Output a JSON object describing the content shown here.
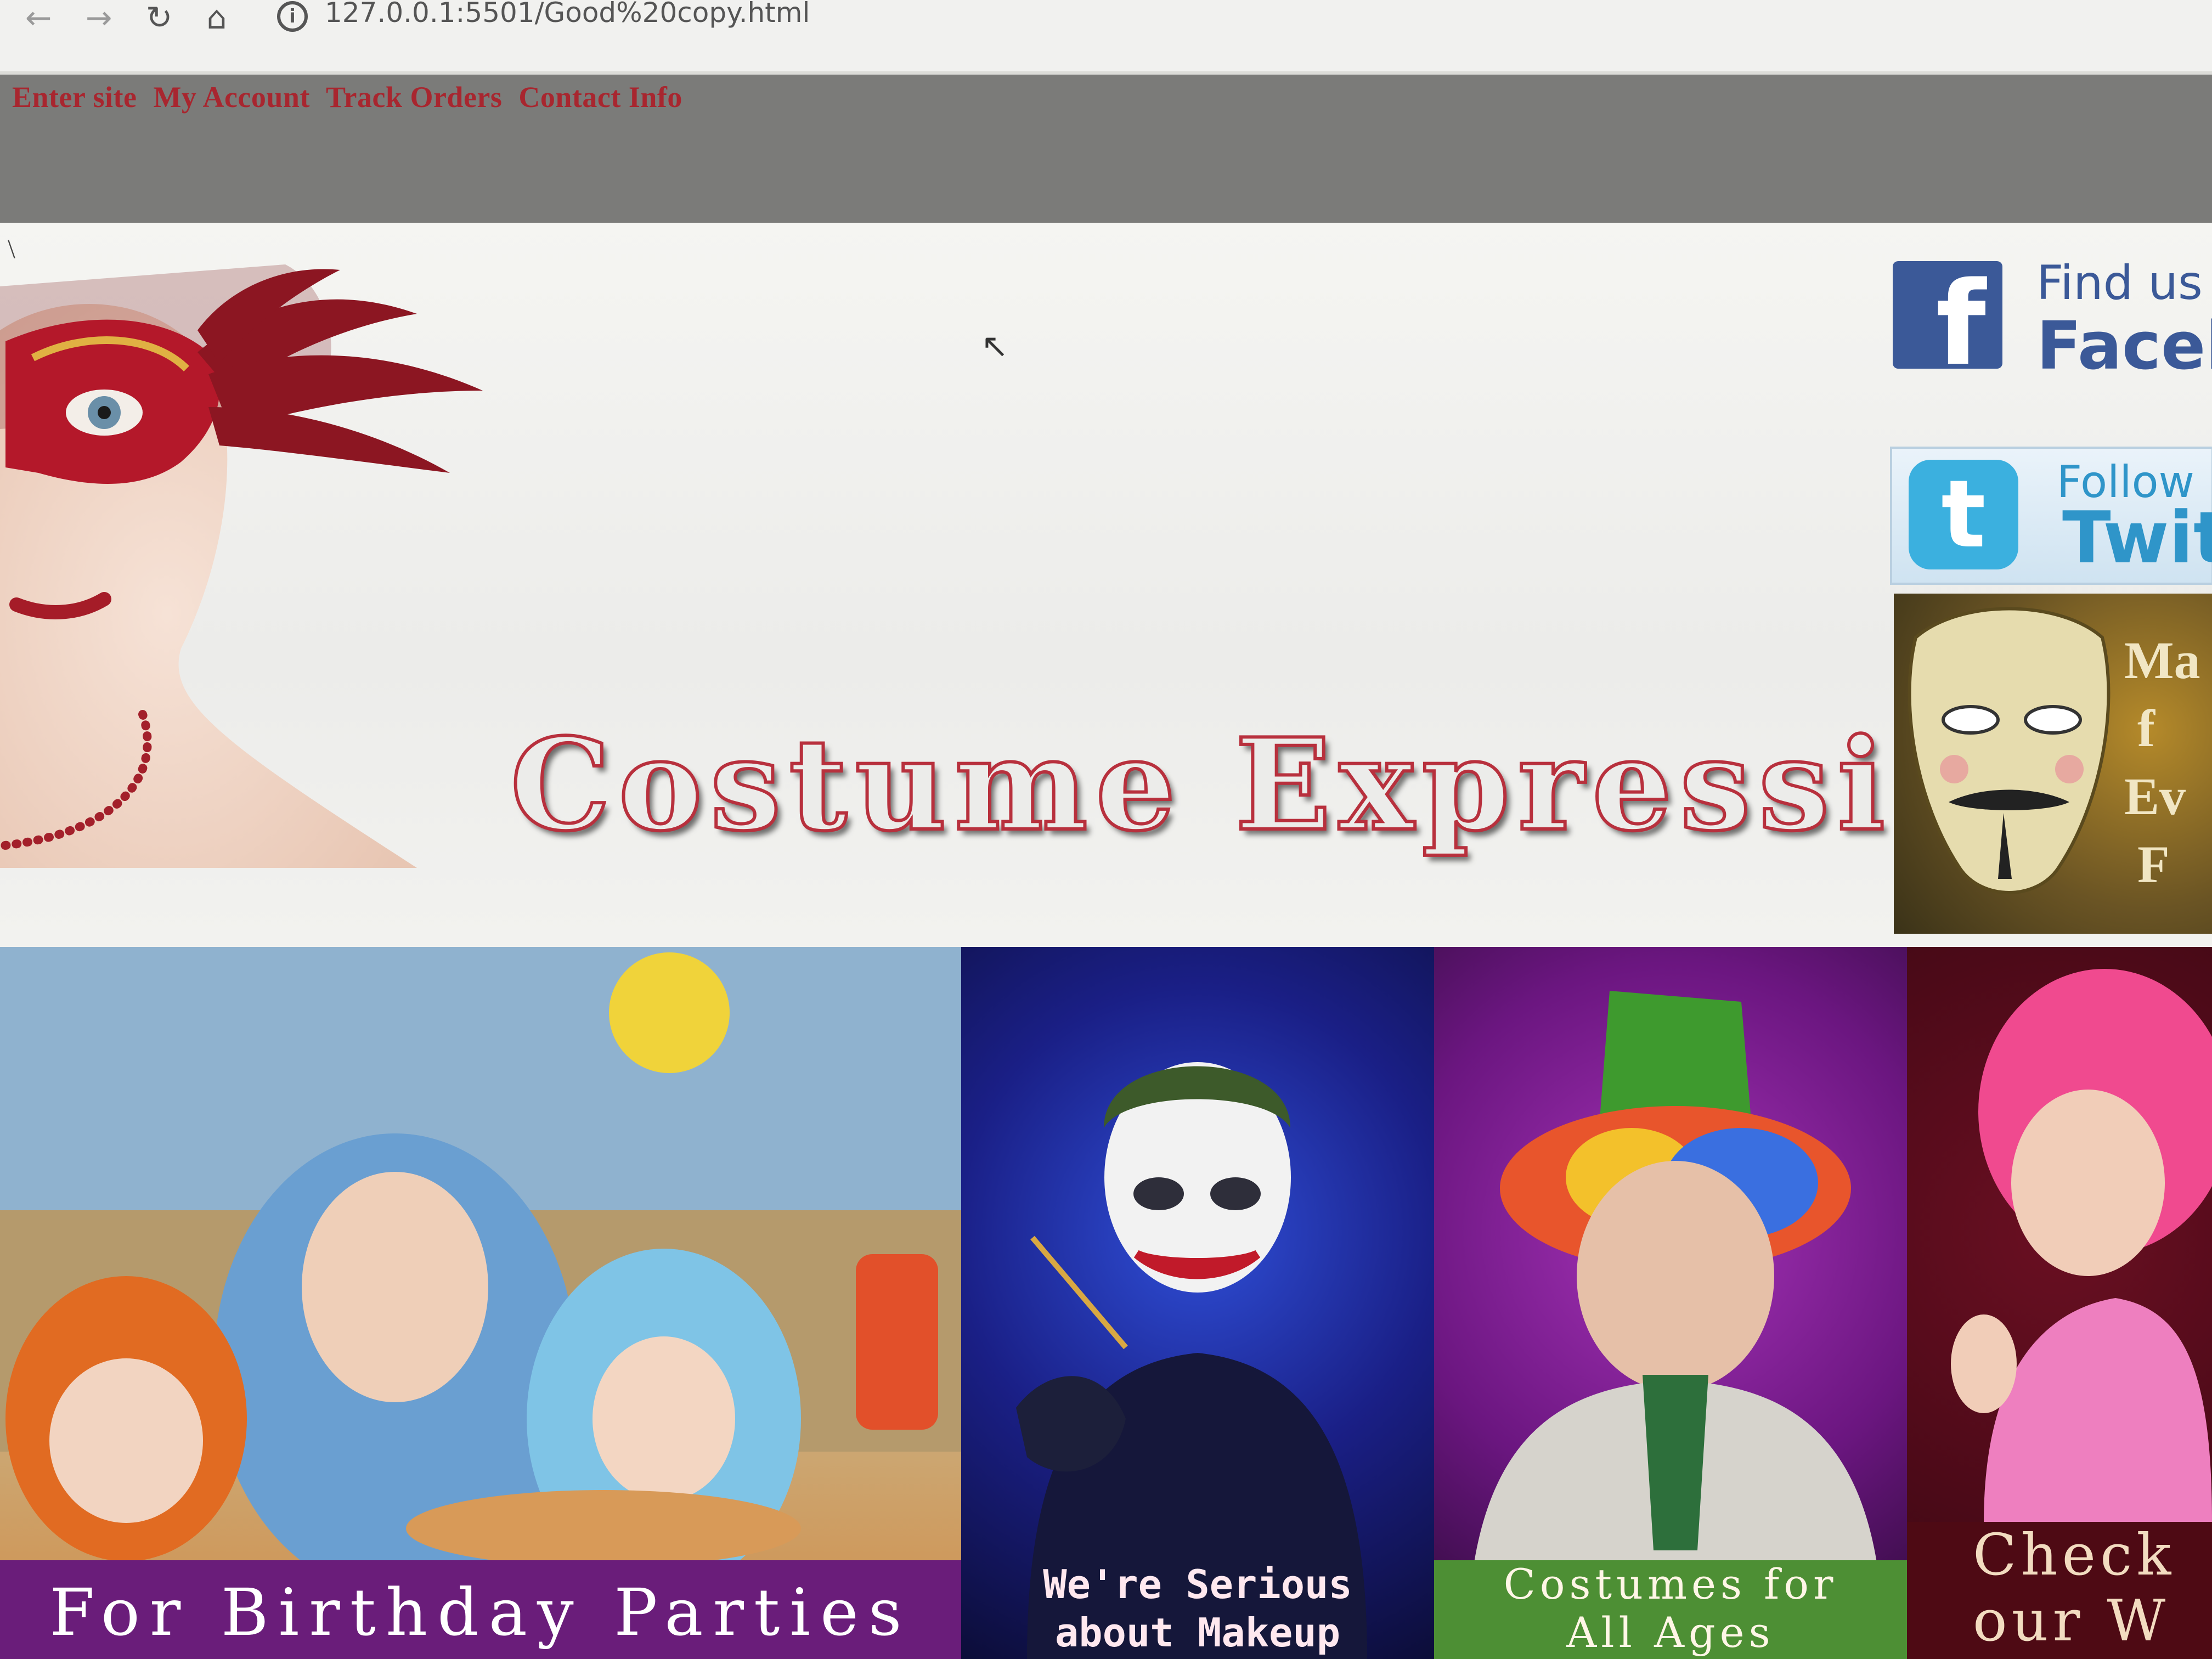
{
  "browser": {
    "back_icon": "←",
    "forward_icon": "→",
    "reload_icon": "↻",
    "home_icon": "⌂",
    "info_icon": "i",
    "url": "127.0.0.1:5501/Good%20copy.html"
  },
  "nav": {
    "links": [
      "Enter site",
      "My Account",
      "Track Orders",
      "Contact Info"
    ]
  },
  "header": {
    "stray_char": "\\",
    "title": "Costume Expressions"
  },
  "social": {
    "facebook_glyph": "f",
    "facebook_line1": "Find us o",
    "facebook_line2": "Faceb",
    "twitter_glyph": "t",
    "twitter_line1": "Follow",
    "twitter_line2": "Twit",
    "mask_ad_text": "Ma\n f\nEv\n F"
  },
  "gallery": {
    "captions": [
      "For Birthday Parties",
      "We're Serious\nabout Makeup",
      "Costumes for\nAll Ages",
      "Check\nour W"
    ]
  },
  "colors": {
    "link_red": "#a8262f",
    "nav_bar_gray": "#7b7b79",
    "facebook_blue": "#3b5998",
    "twitter_blue": "#3bb0df"
  },
  "cursor_icon": "↖"
}
